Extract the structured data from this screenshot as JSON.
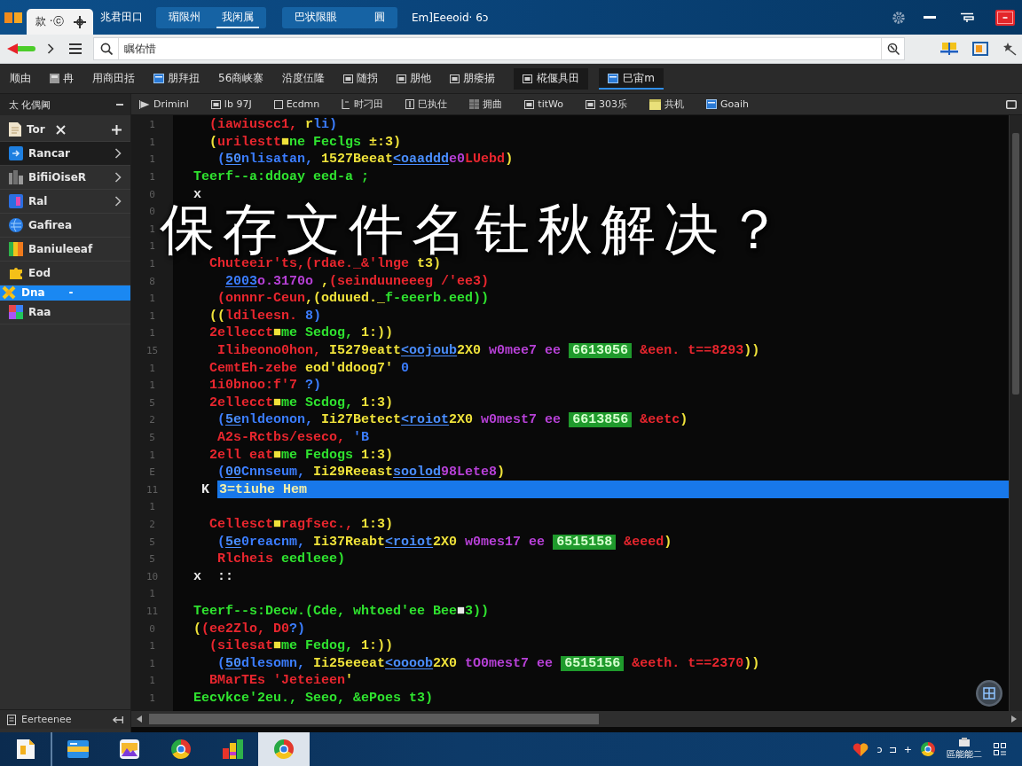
{
  "title_bar": {
    "tabs": [
      {
        "label": "款 ·ⓒ",
        "selected": true
      }
    ],
    "app_label": "兆君田口",
    "tab_groups": [
      {
        "tabs": [
          {
            "label": "瑂限州",
            "selected": false
          },
          {
            "label": "我闲属",
            "selected": true
          }
        ]
      },
      {
        "tabs": [
          {
            "label": "巴状限眼",
            "selected": false
          },
          {
            "label": "圓",
            "selected": false
          }
        ]
      }
    ],
    "caption": "Em]Eeeoid· 6ɔ"
  },
  "address_bar": {
    "search": {
      "value": "瞩佑惜"
    }
  },
  "menu": {
    "items": [
      "顺由",
      "冉",
      "用商田括",
      "朋拜扭",
      "56商峡寨",
      "沿度伍隆",
      "随拐",
      "朋他",
      "朋痿揚"
    ],
    "tabs": [
      {
        "label": "椛偃具田",
        "selected": false
      },
      {
        "label": "巳宙m",
        "selected": true
      }
    ]
  },
  "sidebar": {
    "title": "太 化偶阃",
    "items": [
      {
        "kind": "closable",
        "label": "Tor",
        "selected": false,
        "hovered": false
      },
      {
        "kind": "expandable",
        "label": "Rancar",
        "selected": false,
        "hovered": true
      },
      {
        "kind": "expandable",
        "label": "BifiiOiseR",
        "selected": false,
        "hovered": false
      },
      {
        "kind": "expandable",
        "label": "Ral",
        "selected": false,
        "hovered": false
      },
      {
        "kind": "plain",
        "label": "Gafirea",
        "selected": false,
        "hovered": false
      },
      {
        "kind": "plain",
        "label": "Baniuleeaf",
        "selected": false,
        "hovered": false
      },
      {
        "kind": "plain",
        "label": "Eod",
        "selected": false,
        "hovered": false
      },
      {
        "kind": "plain",
        "label": "Dna",
        "suffix": "-",
        "selected": true,
        "hovered": false
      },
      {
        "kind": "plain",
        "label": "Raa",
        "selected": false,
        "hovered": false
      }
    ],
    "footer": "Eerteenee"
  },
  "editor": {
    "tabs": [
      "Driminl",
      "lb 97J",
      "Ecdmn",
      "时刁田",
      "巳执仕",
      "拥曲",
      "titWo",
      "303乐",
      "共机",
      "Goaih"
    ],
    "overlay_title": "保存文件名钍秋解决？",
    "lines": [
      {
        "number": "1",
        "segments": [
          {
            "kind": "text",
            "text": "  (iawiuscc1, ",
            "color": "#e8262e"
          },
          {
            "kind": "text",
            "text": "r",
            "color": "#efe23a"
          },
          {
            "kind": "text",
            "text": "li)",
            "color": "#3b7dff"
          }
        ]
      },
      {
        "number": "1",
        "segments": [
          {
            "kind": "text",
            "text": "  (",
            "color": "#efe23a"
          },
          {
            "kind": "text",
            "text": "urilestt",
            "color": "#e8262e"
          },
          {
            "kind": "text",
            "text": "■",
            "color": "#efe23a"
          },
          {
            "kind": "text",
            "text": "ne Feclgs ",
            "color": "#2fe22f"
          },
          {
            "kind": "text",
            "text": "±:3)",
            "color": "#efe23a"
          }
        ]
      },
      {
        "number": "1",
        "segments": [
          {
            "kind": "text",
            "text": "   (",
            "color": "#3b7dff"
          },
          {
            "kind": "underline",
            "text": "50",
            "color": "#4a8eff"
          },
          {
            "kind": "text",
            "text": "nlisatan, ",
            "color": "#3b7dff"
          },
          {
            "kind": "text",
            "text": "1527Beeat",
            "color": "#efe23a"
          },
          {
            "kind": "underline",
            "text": "<oaaddd",
            "color": "#4a8eff"
          },
          {
            "kind": "text",
            "text": "e0",
            "color": "#b640d6"
          },
          {
            "kind": "text",
            "text": "LUebd",
            "color": "#e8262e"
          },
          {
            "kind": "text",
            "text": ")",
            "color": "#efe23a"
          }
        ]
      },
      {
        "number": "1",
        "segments": [
          {
            "kind": "text",
            "text": "Teerf--a:ddoay eed-a ;",
            "color": "#2fe22f"
          }
        ]
      },
      {
        "number": "0",
        "segments": [
          {
            "kind": "text",
            "text": "x",
            "color": "#e8e8e8"
          }
        ]
      },
      {
        "number": "0"
      },
      {
        "number": "1"
      },
      {
        "number": "1"
      },
      {
        "number": "1",
        "segments": [
          {
            "kind": "text",
            "text": "  Chuteeir'ts,(rdae._&'lnge ",
            "color": "#e8262e"
          },
          {
            "kind": "text",
            "text": "t3)",
            "color": "#efe23a"
          }
        ]
      },
      {
        "number": "8",
        "segments": [
          {
            "kind": "underline",
            "text": "    2003",
            "color": "#3b7dff"
          },
          {
            "kind": "text",
            "text": "o.3170o",
            "color": "#b640d6"
          },
          {
            "kind": "text",
            "text": " ,",
            "color": "#efe23a"
          },
          {
            "kind": "text",
            "text": "(seinduuneeeg /'ee3)",
            "color": "#e8262e"
          }
        ]
      },
      {
        "number": "1",
        "segments": [
          {
            "kind": "text",
            "text": "   (onnnr-Ceun",
            "color": "#e8262e"
          },
          {
            "kind": "text",
            "text": ",(oduued._",
            "color": "#efe23a"
          },
          {
            "kind": "text",
            "text": "f-eeerb.eed))",
            "color": "#2fe22f"
          }
        ]
      },
      {
        "number": "1",
        "segments": [
          {
            "kind": "text",
            "text": "  ((",
            "color": "#efe23a"
          },
          {
            "kind": "text",
            "text": "ldileesn. ",
            "color": "#e8262e"
          },
          {
            "kind": "text",
            "text": "8)",
            "color": "#3b7dff"
          }
        ]
      },
      {
        "number": "1",
        "segments": [
          {
            "kind": "text",
            "text": "  2ellecct",
            "color": "#e8262e"
          },
          {
            "kind": "text",
            "text": "■",
            "color": "#efe23a"
          },
          {
            "kind": "text",
            "text": "me Sedog, ",
            "color": "#2fe22f"
          },
          {
            "kind": "text",
            "text": "1:))",
            "color": "#efe23a"
          }
        ]
      },
      {
        "number": "15",
        "segments": [
          {
            "kind": "text",
            "text": "   Ilibeono0hon, ",
            "color": "#e8262e"
          },
          {
            "kind": "text",
            "text": "I5279eatt",
            "color": "#efe23a"
          },
          {
            "kind": "underline",
            "text": "<oojoub",
            "color": "#4a8eff"
          },
          {
            "kind": "text",
            "text": "2X0 ",
            "color": "#efe23a"
          },
          {
            "kind": "text",
            "text": "w0mee7 ee ",
            "color": "#b640d6"
          },
          {
            "kind": "badge",
            "text": "6613056",
            "color": "#1f9a2c"
          },
          {
            "kind": "text",
            "text": " &een. t==8293",
            "color": "#e8262e"
          },
          {
            "kind": "text",
            "text": "))",
            "color": "#efe23a"
          }
        ]
      },
      {
        "number": "1",
        "segments": [
          {
            "kind": "text",
            "text": "  CemtEh-zebe ",
            "color": "#e8262e"
          },
          {
            "kind": "text",
            "text": "eod'ddoog7' ",
            "color": "#efe23a"
          },
          {
            "kind": "text",
            "text": "0",
            "color": "#3b7dff"
          }
        ]
      },
      {
        "number": "1",
        "segments": [
          {
            "kind": "text",
            "text": "  1i0bnoo:f'7 ",
            "color": "#e8262e"
          },
          {
            "kind": "text",
            "text": "?)",
            "color": "#3b7dff"
          }
        ]
      },
      {
        "number": "5",
        "segments": [
          {
            "kind": "text",
            "text": "  2ellecct",
            "color": "#e8262e"
          },
          {
            "kind": "text",
            "text": "■",
            "color": "#efe23a"
          },
          {
            "kind": "text",
            "text": "me Scdog, ",
            "color": "#2fe22f"
          },
          {
            "kind": "text",
            "text": "1:3)",
            "color": "#efe23a"
          }
        ]
      },
      {
        "number": "2",
        "segments": [
          {
            "kind": "text",
            "text": "   (",
            "color": "#3b7dff"
          },
          {
            "kind": "underline",
            "text": "5e",
            "color": "#4a8eff"
          },
          {
            "kind": "text",
            "text": "nldeonon, ",
            "color": "#3b7dff"
          },
          {
            "kind": "text",
            "text": "Ii27Betect",
            "color": "#efe23a"
          },
          {
            "kind": "underline",
            "text": "<roiot",
            "color": "#4a8eff"
          },
          {
            "kind": "text",
            "text": "2X0 ",
            "color": "#efe23a"
          },
          {
            "kind": "text",
            "text": "w0mest7 ee ",
            "color": "#b640d6"
          },
          {
            "kind": "badge",
            "text": "6613856",
            "color": "#1f9a2c"
          },
          {
            "kind": "text",
            "text": " &eetc",
            "color": "#e8262e"
          },
          {
            "kind": "text",
            "text": ")",
            "color": "#efe23a"
          }
        ]
      },
      {
        "number": "5",
        "segments": [
          {
            "kind": "text",
            "text": "   A2s-Rctbs/eseco, ",
            "color": "#e8262e"
          },
          {
            "kind": "text",
            "text": "'B",
            "color": "#3b7dff"
          }
        ]
      },
      {
        "number": "1",
        "segments": [
          {
            "kind": "text",
            "text": "  2ell eat",
            "color": "#e8262e"
          },
          {
            "kind": "text",
            "text": "■",
            "color": "#efe23a"
          },
          {
            "kind": "text",
            "text": "me Fedogs ",
            "color": "#2fe22f"
          },
          {
            "kind": "text",
            "text": "1:3)",
            "color": "#efe23a"
          }
        ]
      },
      {
        "number": "E",
        "segments": [
          {
            "kind": "text",
            "text": "   (",
            "color": "#3b7dff"
          },
          {
            "kind": "underline",
            "text": "00",
            "color": "#4a8eff"
          },
          {
            "kind": "text",
            "text": "Cnnseum, ",
            "color": "#3b7dff"
          },
          {
            "kind": "text",
            "text": "Ii29Reeast",
            "color": "#efe23a"
          },
          {
            "kind": "underline",
            "text": "soolod",
            "color": "#4a8eff"
          },
          {
            "kind": "text",
            "text": "98Lete8",
            "color": "#b640d6"
          },
          {
            "kind": "text",
            "text": ")",
            "color": "#efe23a"
          }
        ]
      },
      {
        "number": "11",
        "segments": [
          {
            "kind": "text",
            "text": " K ",
            "color": "#e8e8e8"
          },
          {
            "kind": "selection",
            "text": "3=tiuhe Hem",
            "color": "#1878ea"
          }
        ]
      },
      {
        "number": "1"
      },
      {
        "number": "2",
        "segments": [
          {
            "kind": "text",
            "text": "  Cellesct",
            "color": "#e8262e"
          },
          {
            "kind": "text",
            "text": "■",
            "color": "#efe23a"
          },
          {
            "kind": "text",
            "text": "ragfsec., ",
            "color": "#e8262e"
          },
          {
            "kind": "text",
            "text": "1:3)",
            "color": "#efe23a"
          }
        ]
      },
      {
        "number": "5",
        "segments": [
          {
            "kind": "text",
            "text": "   (",
            "color": "#3b7dff"
          },
          {
            "kind": "underline",
            "text": "5e",
            "color": "#4a8eff"
          },
          {
            "kind": "text",
            "text": "0reacnm, ",
            "color": "#3b7dff"
          },
          {
            "kind": "text",
            "text": "Ii37Reabt",
            "color": "#efe23a"
          },
          {
            "kind": "underline",
            "text": "<roiot",
            "color": "#4a8eff"
          },
          {
            "kind": "text",
            "text": "2X0 ",
            "color": "#efe23a"
          },
          {
            "kind": "text",
            "text": "w0mes17 ee ",
            "color": "#b640d6"
          },
          {
            "kind": "badge",
            "text": "6515158",
            "color": "#1f9a2c"
          },
          {
            "kind": "text",
            "text": " &eeed",
            "color": "#e8262e"
          },
          {
            "kind": "text",
            "text": ")",
            "color": "#efe23a"
          }
        ]
      },
      {
        "number": "5",
        "segments": [
          {
            "kind": "text",
            "text": "   Rlcheis ",
            "color": "#e8262e"
          },
          {
            "kind": "text",
            "text": "eedleee)",
            "color": "#2fe22f"
          }
        ]
      },
      {
        "number": "10",
        "segments": [
          {
            "kind": "text",
            "text": "x  ::",
            "color": "#e8e8e8"
          }
        ]
      },
      {
        "number": "1"
      },
      {
        "number": "11",
        "segments": [
          {
            "kind": "text",
            "text": "Teerf--s:Decw.(Cde, whtoed'ee Bee",
            "color": "#2fe22f"
          },
          {
            "kind": "text",
            "text": "■",
            "color": "#e8e8e8"
          },
          {
            "kind": "text",
            "text": "3))",
            "color": "#2fe22f"
          }
        ]
      },
      {
        "number": "0",
        "segments": [
          {
            "kind": "text",
            "text": "(",
            "color": "#efe23a"
          },
          {
            "kind": "text",
            "text": "(ee2Zlo, D0",
            "color": "#e8262e"
          },
          {
            "kind": "text",
            "text": "?)",
            "color": "#3b7dff"
          }
        ]
      },
      {
        "number": "1",
        "segments": [
          {
            "kind": "text",
            "text": "  (silesat",
            "color": "#e8262e"
          },
          {
            "kind": "text",
            "text": "■",
            "color": "#efe23a"
          },
          {
            "kind": "text",
            "text": "me Fedog, ",
            "color": "#2fe22f"
          },
          {
            "kind": "text",
            "text": "1:))",
            "color": "#efe23a"
          }
        ]
      },
      {
        "number": "1",
        "segments": [
          {
            "kind": "text",
            "text": "   (",
            "color": "#3b7dff"
          },
          {
            "kind": "underline",
            "text": "50",
            "color": "#4a8eff"
          },
          {
            "kind": "text",
            "text": "dlesomn, ",
            "color": "#3b7dff"
          },
          {
            "kind": "text",
            "text": "Ii25eeeat",
            "color": "#efe23a"
          },
          {
            "kind": "underline",
            "text": "<oooob",
            "color": "#4a8eff"
          },
          {
            "kind": "text",
            "text": "2X0 ",
            "color": "#efe23a"
          },
          {
            "kind": "text",
            "text": "tO0mest7 ee ",
            "color": "#b640d6"
          },
          {
            "kind": "badge",
            "text": "6515156",
            "color": "#1f9a2c"
          },
          {
            "kind": "text",
            "text": " &eeth. t==2370",
            "color": "#e8262e"
          },
          {
            "kind": "text",
            "text": "))",
            "color": "#efe23a"
          }
        ]
      },
      {
        "number": "1",
        "segments": [
          {
            "kind": "text",
            "text": "  BMarTEs 'Jeteieen",
            "color": "#e8262e"
          },
          {
            "kind": "text",
            "text": "'",
            "color": "#efe23a"
          }
        ]
      },
      {
        "number": "1",
        "segments": [
          {
            "kind": "text",
            "text": "Eecvkce'2eu., Seeo, &ePoes t3)",
            "color": "#2fe22f"
          }
        ]
      }
    ]
  },
  "taskbar": {
    "apps": [
      {
        "selected": false
      },
      {
        "selected": false
      },
      {
        "selected": false
      },
      {
        "selected": false
      },
      {
        "selected": false
      },
      {
        "selected": true
      }
    ],
    "tray_text": "ɔ ⊐ +",
    "clock": "區能能二"
  }
}
